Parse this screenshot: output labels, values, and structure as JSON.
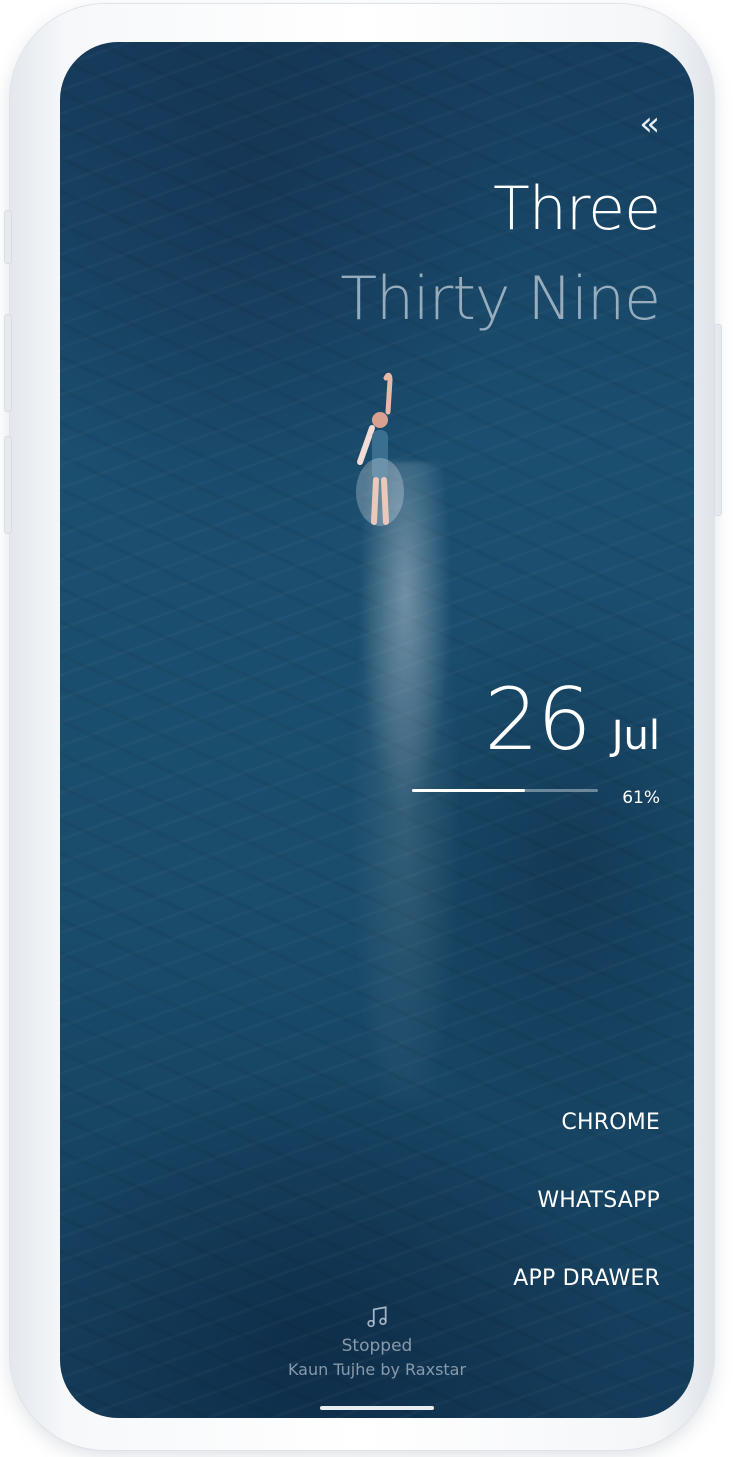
{
  "nav": {
    "back_glyph": "«",
    "back_icon": "double-chevron-left-icon"
  },
  "clock": {
    "hour_text": "Three",
    "minute_text": "Thirty Nine"
  },
  "date": {
    "day": "26",
    "month": "Jul"
  },
  "battery": {
    "percent": 61,
    "label": "61%"
  },
  "apps": [
    {
      "label": "CHROME"
    },
    {
      "label": "WHATSAPP"
    },
    {
      "label": "APP DRAWER"
    }
  ],
  "music": {
    "icon": "music-note-icon",
    "status": "Stopped",
    "track": "Kaun Tujhe by Raxstar"
  },
  "colors": {
    "wallpaper": "#1b4f70",
    "text_primary": "#ffffff",
    "text_muted": "#c8d4de"
  }
}
